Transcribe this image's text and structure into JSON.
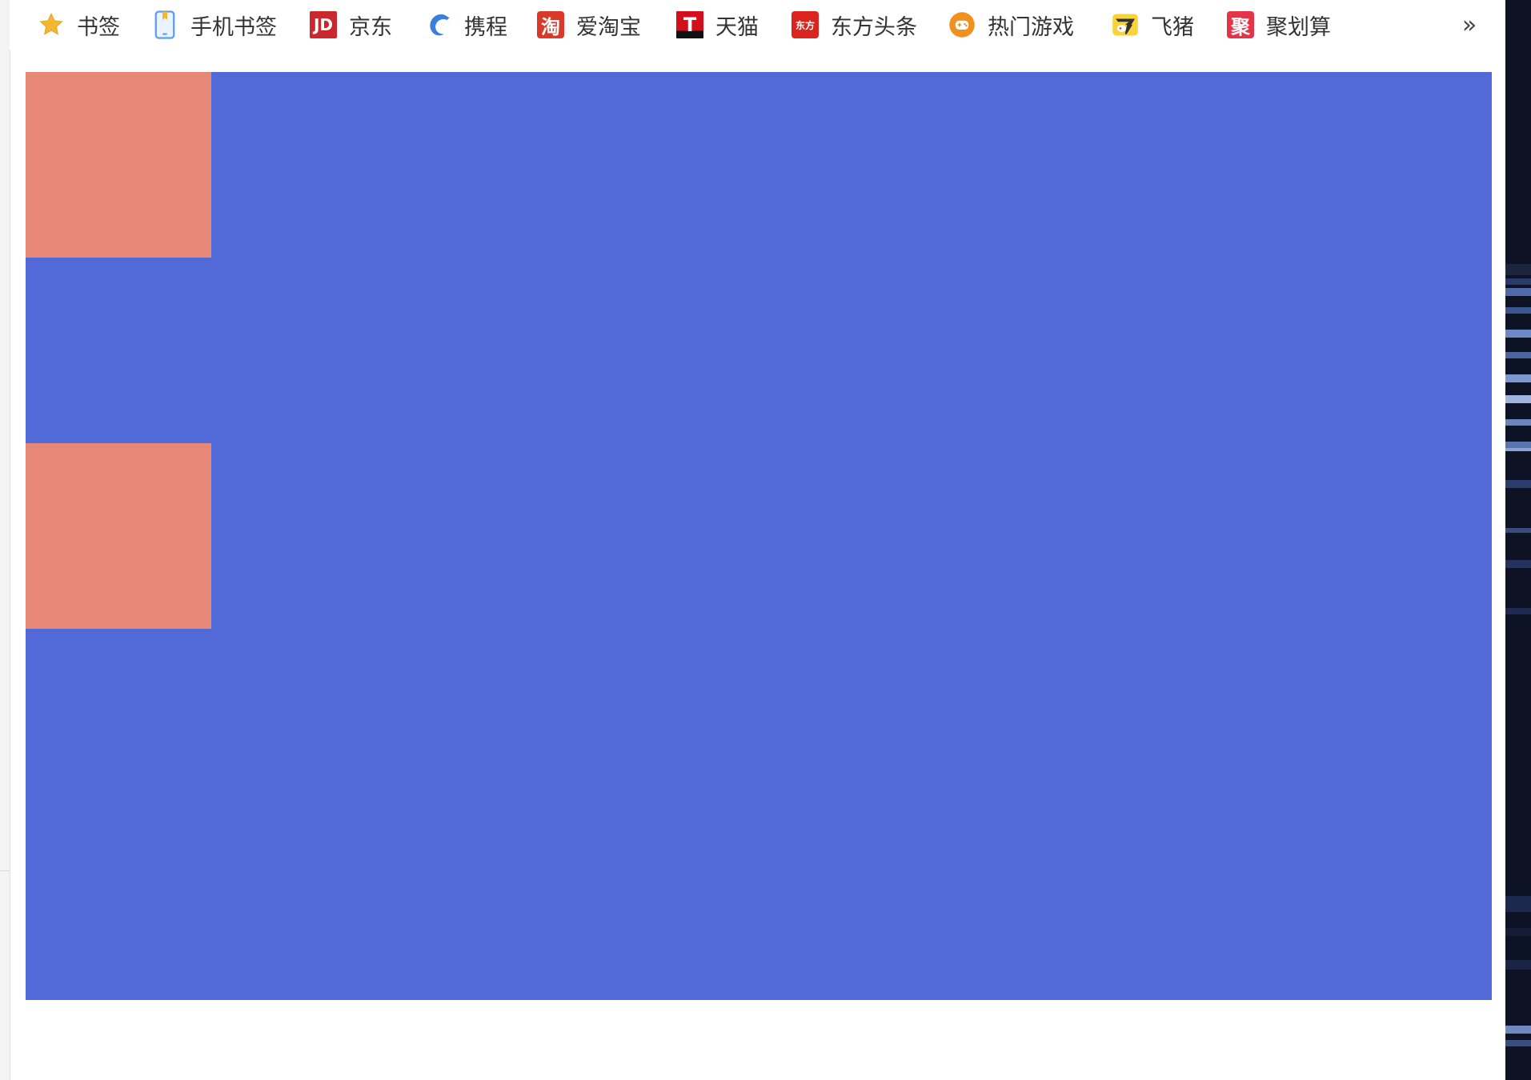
{
  "bookmarks_bar": {
    "items": [
      {
        "label": "书签",
        "icon": "star-icon",
        "color": "#f5b731"
      },
      {
        "label": "手机书签",
        "icon": "mobile-bookmark-icon",
        "color": "#5a9cf0"
      },
      {
        "label": "京东",
        "icon": "jd-logo-icon",
        "icon_text": "JD",
        "color": "#c9282d"
      },
      {
        "label": "携程",
        "icon": "ctrip-dolphin-icon",
        "color": "#3a7ee0"
      },
      {
        "label": "爱淘宝",
        "icon": "taobao-logo-icon",
        "icon_text": "淘",
        "color": "#d9392a"
      },
      {
        "label": "天猫",
        "icon": "tmall-logo-icon",
        "icon_text": "T",
        "color": "#d40f1c"
      },
      {
        "label": "东方头条",
        "icon": "eastday-logo-icon",
        "icon_text": "东方",
        "color": "#d9251d"
      },
      {
        "label": "热门游戏",
        "icon": "games-icon",
        "color": "#f0901e"
      },
      {
        "label": "飞猪",
        "icon": "fliggy-logo-icon",
        "color": "#f8d43a"
      },
      {
        "label": "聚划算",
        "icon": "juhuasuan-logo-icon",
        "icon_text": "聚",
        "color": "#e5334a"
      }
    ],
    "more_label": "»"
  },
  "canvas": {
    "background_color": "#5269d8",
    "box_color": "#e78876",
    "box_count": 2
  }
}
